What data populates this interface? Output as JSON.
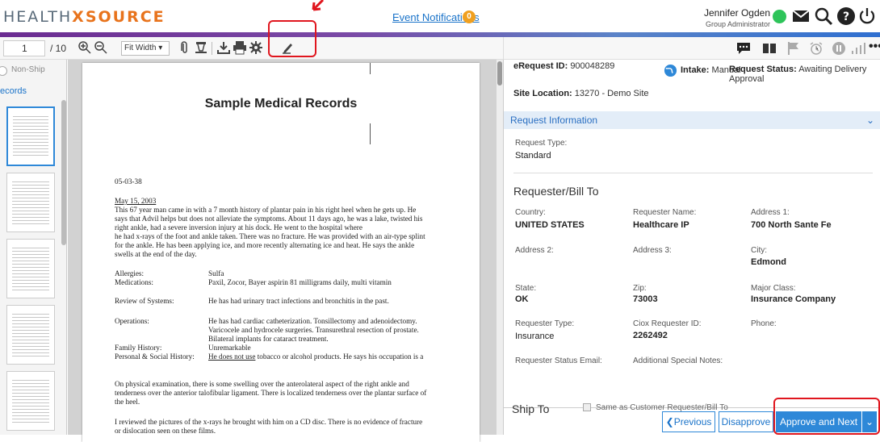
{
  "header": {
    "logo_left": "HEALTH",
    "logo_x": "X",
    "logo_right": "SOURCE",
    "event_link": "Event Notifications",
    "event_count": "0",
    "user_name": "Jennifer Ogden",
    "user_role": "Group Administrator",
    "status_color": "#2ec45a"
  },
  "toolbar": {
    "page_current": "1",
    "page_total": "/ 10",
    "fit_select": "Fit Width"
  },
  "thumbnails": {
    "nonship_label": "Non-Ship",
    "records_label": "ecords"
  },
  "document": {
    "title": "Sample Medical Records",
    "date_code": "05-03-38",
    "visit_date": "May 15, 2003",
    "para1": [
      "This 67 year man came in with a 7 month history of plantar pain in his right heel when he gets up.  He",
      "says that Advil helps but does not alleviate the symptoms.  About 11 days ago, he was a lake, twisted his",
      "right ankle, had a severe inversion injury at his dock.  He went to the                          hospital where",
      "he had x-rays of the foot and ankle taken.  There was no fracture.  He was provided with an air-type splint",
      "for the ankle.  He has been applying ice, and more recently alternating ice and heat.  He says the ankle",
      "swells at the end of the day."
    ],
    "allergies_label": "Allergies:",
    "allergies_value": "Sulfa",
    "medications_label": "Medications:",
    "medications_value": "Paxil, Zocor, Bayer aspirin 81 milligrams daily, multi vitamin",
    "ros_label": "Review of Systems:",
    "ros_value": "He has had urinary tract infections and bronchitis in the past.",
    "operations_label": "Operations:",
    "operations_lines": [
      "He has had cardiac catheterization.  Tonsillectomy and adenoidectomy.",
      "Varicocele and hydrocele surgeries.  Transurethral resection of prostate.",
      "Bilateral implants for cataract treatment."
    ],
    "family_label": "Family History:",
    "family_value": "Unremarkable",
    "social_label": "Personal & Social History:",
    "social_value_u": "He does not use",
    "social_value_rest": " tobacco or alcohol products.  He says his occupation is a",
    "para2": [
      "On physical examination, there is some swelling over the anterolateral aspect of the right ankle and",
      "tenderness over the anterior talofibular ligament.  There is localized tenderness over the plantar surface of",
      "the heel."
    ],
    "para3": [
      "I reviewed the pictures of the x-rays he brought with him on a CD disc.  There is no evidence of fracture",
      "or dislocation seen on these films."
    ]
  },
  "request": {
    "erequest_label": "eRequest ID:",
    "erequest_id": "900048289",
    "intake_label": "Intake:",
    "intake_value": "Manual",
    "status_label": "Request Status:",
    "status_value_1": "Awaiting Delivery",
    "status_value_2": "Approval",
    "site_label": "Site Location:",
    "site_value": "13270 - Demo Site",
    "section_title": "Request Information",
    "request_type_label": "Request Type:",
    "request_type_value": "Standard",
    "requester_heading": "Requester/Bill To",
    "fields": {
      "country_label": "Country:",
      "country_value": "UNITED STATES",
      "req_name_label": "Requester Name:",
      "req_name_value": "Healthcare IP",
      "addr1_label": "Address 1:",
      "addr1_value": "700 North Sante Fe",
      "addr2_label": "Address 2:",
      "addr3_label": "Address 3:",
      "city_label": "City:",
      "city_value": "Edmond",
      "state_label": "State:",
      "state_value": "OK",
      "zip_label": "Zip:",
      "zip_value": "73003",
      "major_label": "Major Class:",
      "major_value": "Insurance Company",
      "req_type_label": "Requester Type:",
      "req_type_value": "Insurance",
      "ciox_label": "Ciox Requester ID:",
      "ciox_value": "2262492",
      "phone_label": "Phone:",
      "req_email_label": "Requester Status Email:",
      "notes_label": "Additional Special Notes:"
    },
    "ship_to": "Ship To",
    "same_as": "Same as Customer Requester/Bill To"
  },
  "actions": {
    "previous": "Previous",
    "disapprove": "Disapprove",
    "approve_next": "Approve and Next"
  }
}
